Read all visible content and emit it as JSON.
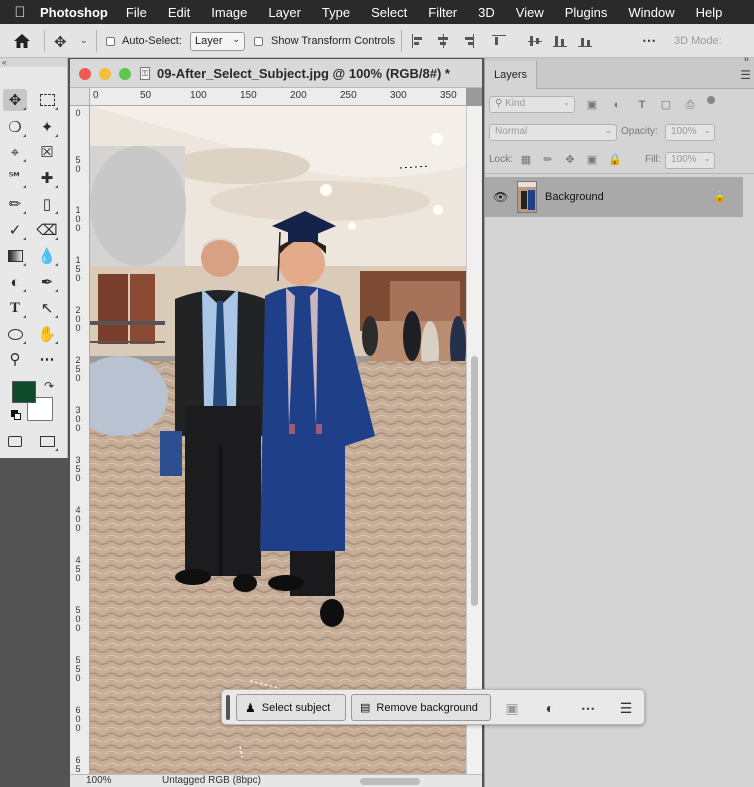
{
  "menubar": {
    "app": "Photoshop",
    "items": [
      "File",
      "Edit",
      "Image",
      "Layer",
      "Type",
      "Select",
      "Filter",
      "3D",
      "View",
      "Plugins",
      "Window",
      "Help"
    ]
  },
  "options": {
    "auto_select_label": "Auto-Select:",
    "auto_select_value": "Layer",
    "show_transform_label": "Show Transform Controls",
    "mode_3d_label": "3D Mode:"
  },
  "document": {
    "title": "09-After_Select_Subject.jpg @ 100% (RGB/8#) *",
    "ruler_h": [
      "0",
      "50",
      "100",
      "150",
      "200",
      "250",
      "300",
      "350"
    ],
    "ruler_v": [
      "0",
      "50",
      "100",
      "150",
      "200",
      "250",
      "300",
      "350",
      "400",
      "450",
      "500",
      "550",
      "600",
      "650"
    ],
    "zoom": "100%",
    "color_profile": "Untagged RGB (8bpc)"
  },
  "layers": {
    "tab": "Layers",
    "kind_placeholder": "Kind",
    "blend_mode": "Normal",
    "opacity_label": "Opacity:",
    "opacity_value": "100%",
    "lock_label": "Lock:",
    "fill_label": "Fill:",
    "fill_value": "100%",
    "layer_name": "Background"
  },
  "taskbar": {
    "select_subject": "Select subject",
    "remove_background": "Remove background"
  },
  "colors": {
    "foreground": "#0f4a2c",
    "background": "#ffffff",
    "selected_layer_row": "#a9a9a9"
  }
}
